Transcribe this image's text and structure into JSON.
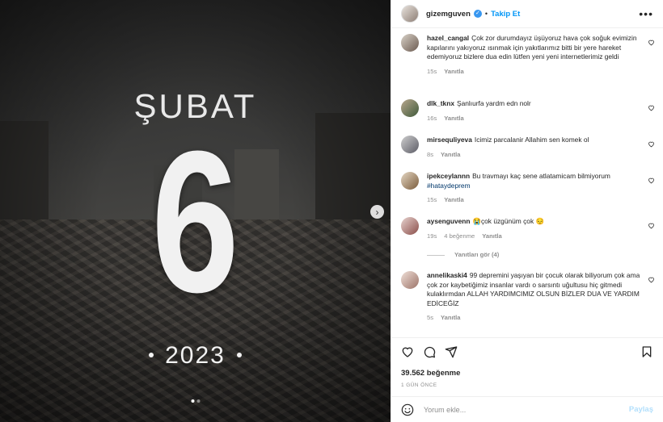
{
  "media": {
    "title": "ŞUBAT",
    "number": "6",
    "year": "2023",
    "next_glyph": "›",
    "pager": {
      "current": 1,
      "total": 2
    }
  },
  "header": {
    "username": "gizemguven",
    "separator": "•",
    "follow_label": "Takip Et",
    "more_glyph": "•••"
  },
  "comments": [
    {
      "user": "hazel_cangal",
      "text": "Çok zor durumdayız üşüyoruz hava çok soğuk evimizin kapılarını yakıyoruz ısınmak için yakıtlarımız bitti bir yere hareket edemiyoruz bizlere dua edin lütfen yeni yeni internetlerimiz geldi",
      "time": "15s",
      "likes": "",
      "reply": "Yanıtla"
    },
    {
      "user": "dlk_tknx",
      "text": "Şanlıurfa yardm edn nolr",
      "time": "16s",
      "likes": "",
      "reply": "Yanıtla"
    },
    {
      "user": "mirsequliyeva",
      "text": "Icimiz parcalanir Allahim sen komek ol",
      "time": "8s",
      "likes": "",
      "reply": "Yanıtla"
    },
    {
      "user": "ipekceylannn",
      "text": "Bu travmayı kaç sene atlatamicam bilmiyorum",
      "hashtag": "#hataydeprem",
      "time": "15s",
      "likes": "",
      "reply": "Yanıtla"
    },
    {
      "user": "aysenguvenn",
      "text": "😭çok üzgünüm çok 😔",
      "time": "19s",
      "likes": "4 beğenme",
      "reply": "Yanıtla"
    },
    {
      "user": "annelikaski4",
      "text": "99 depremini yaşıyan bir çocuk olarak biliyorum çok ama çok zor kaybetiğimiz insanlar vardı o sarsıntı uğultusu hiç gitmedi kulaklırmdan ALLAH YARDIMCIMIZ OLSUN BİZLER DUA VE YARDIM EDİCEĞİZ",
      "time": "5s",
      "likes": "",
      "reply": "Yanıtla"
    }
  ],
  "view_replies": "Yanıtları gör (4)",
  "footer": {
    "likes": "39.562 beğenme",
    "date": "1 GÜN ÖNCE"
  },
  "add_comment": {
    "placeholder": "Yorum ekle...",
    "post_label": "Paylaş"
  },
  "colors": {
    "accent": "#0095f6",
    "post_disabled": "#b2dffc",
    "muted": "#8e8e8e"
  }
}
